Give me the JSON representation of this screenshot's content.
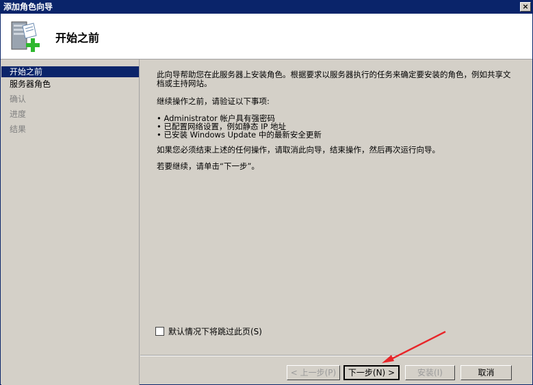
{
  "window": {
    "title": "添加角色向导",
    "close_label": "×"
  },
  "header": {
    "title": "开始之前",
    "icon": "server-add-icon"
  },
  "sidebar": {
    "items": [
      {
        "label": "开始之前",
        "state": "active"
      },
      {
        "label": "服务器角色",
        "state": "enabled"
      },
      {
        "label": "确认",
        "state": "disabled"
      },
      {
        "label": "进度",
        "state": "disabled"
      },
      {
        "label": "结果",
        "state": "disabled"
      }
    ]
  },
  "content": {
    "intro": "此向导帮助您在此服务器上安装角色。根据要求以服务器执行的任务来确定要安装的角色，例如共享文档或主持网站。",
    "verify_heading": "继续操作之前，请验证以下事项:",
    "bullets": [
      "Administrator 帐户具有强密码",
      "已配置网络设置，例如静态 IP 地址",
      "已安装 Windows Update 中的最新安全更新"
    ],
    "cancel_note": "如果您必须结束上述的任何操作，请取消此向导，结束操作，然后再次运行向导。",
    "continue_note": "若要继续，请单击“下一步”。",
    "skip_label": "默认情况下将跳过此页(S)"
  },
  "buttons": {
    "back": "< 上一步(P)",
    "next": "下一步(N) >",
    "install": "安装(I)",
    "cancel": "取消"
  },
  "colors": {
    "titlebar": "#0a246a",
    "annotation_arrow": "#e8262a"
  }
}
